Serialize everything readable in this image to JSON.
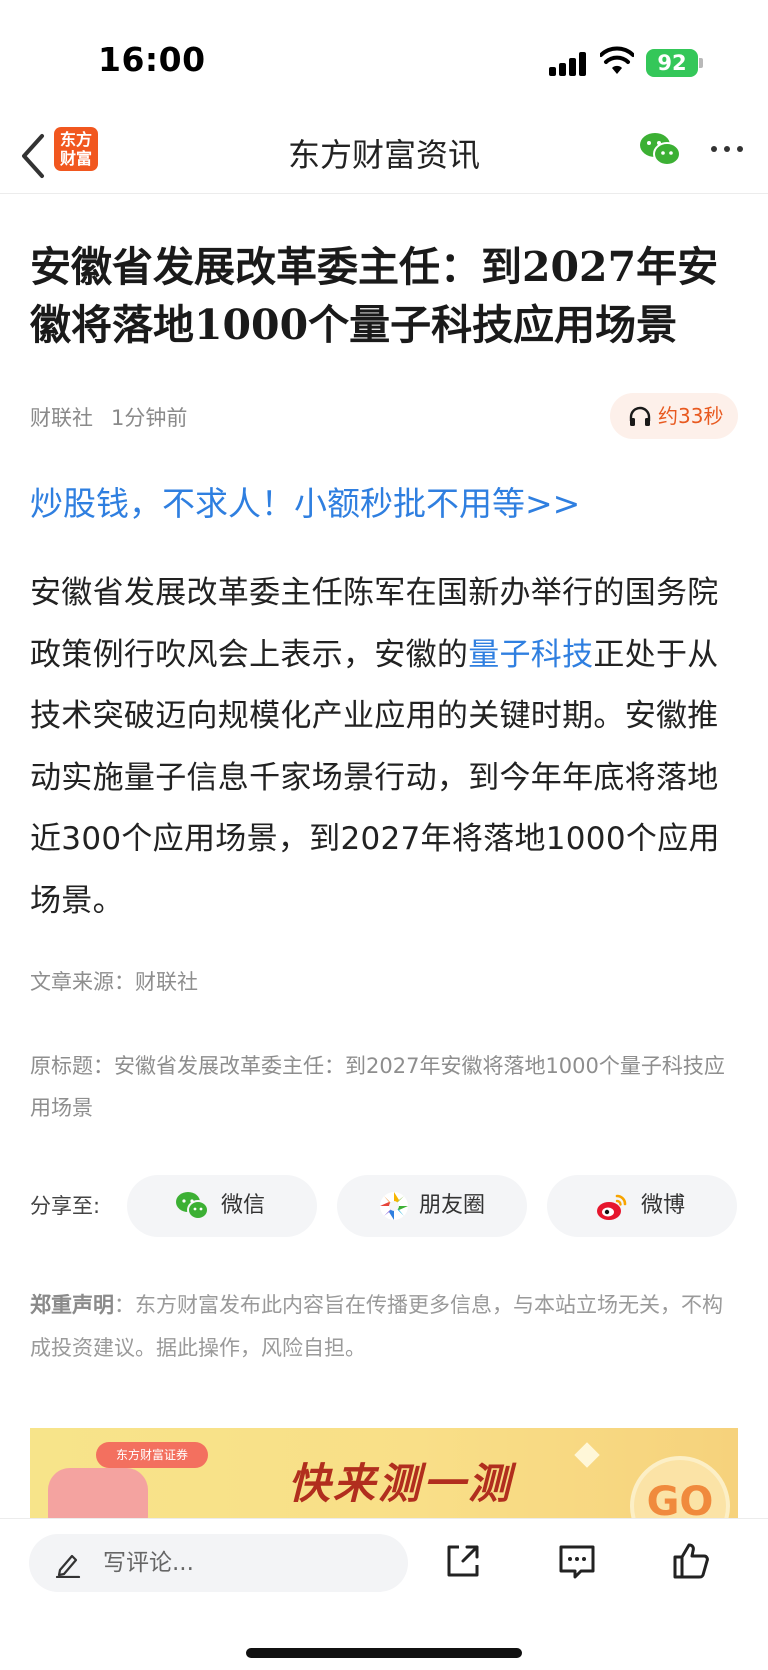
{
  "status_bar": {
    "time": "16:00",
    "battery": "92"
  },
  "nav": {
    "logo_text": "东方\n财富",
    "title": "东方财富资讯"
  },
  "article": {
    "headline": "安徽省发展改革委主任：到2027年安徽将落地1000个量子科技应用场景",
    "source": "财联社",
    "time_ago": "1分钟前",
    "audio_duration": "约33秒",
    "promo_link": "炒股钱，不求人！小额秒批不用等>>",
    "body_part1": "安徽省发展改革委主任陈军在国新办举行的国务院政策例行吹风会上表示，安徽的",
    "body_keyword": "量子科技",
    "body_part2": "正处于从技术突破迈向规模化产业应用的关键时期。安徽推动实施量子信息千家场景行动，到今年年底将落地近300个应用场景，到2027年将落地1000个应用场景。",
    "source_line": "文章来源：财联社",
    "original_title": "原标题：安徽省发展改革委主任：到2027年安徽将落地1000个量子科技应用场景"
  },
  "share": {
    "label": "分享至:",
    "targets": [
      {
        "label": "微信",
        "icon": "wechat-icon"
      },
      {
        "label": "朋友圈",
        "icon": "moments-icon"
      },
      {
        "label": "微博",
        "icon": "weibo-icon"
      }
    ]
  },
  "disclaimer": {
    "title": "郑重声明",
    "text": "：东方财富发布此内容旨在传播更多信息，与本站立场无关，不构成投资建议。据此操作，风险自担。"
  },
  "banner": {
    "badge": "东方财富证券",
    "title": "快来测一测",
    "button": "GO"
  },
  "bottom_bar": {
    "comment_placeholder": "写评论..."
  },
  "colors": {
    "accent_blue": "#2f7fe0",
    "brand_orange": "#f1571f",
    "wechat_green": "#3cb034"
  }
}
